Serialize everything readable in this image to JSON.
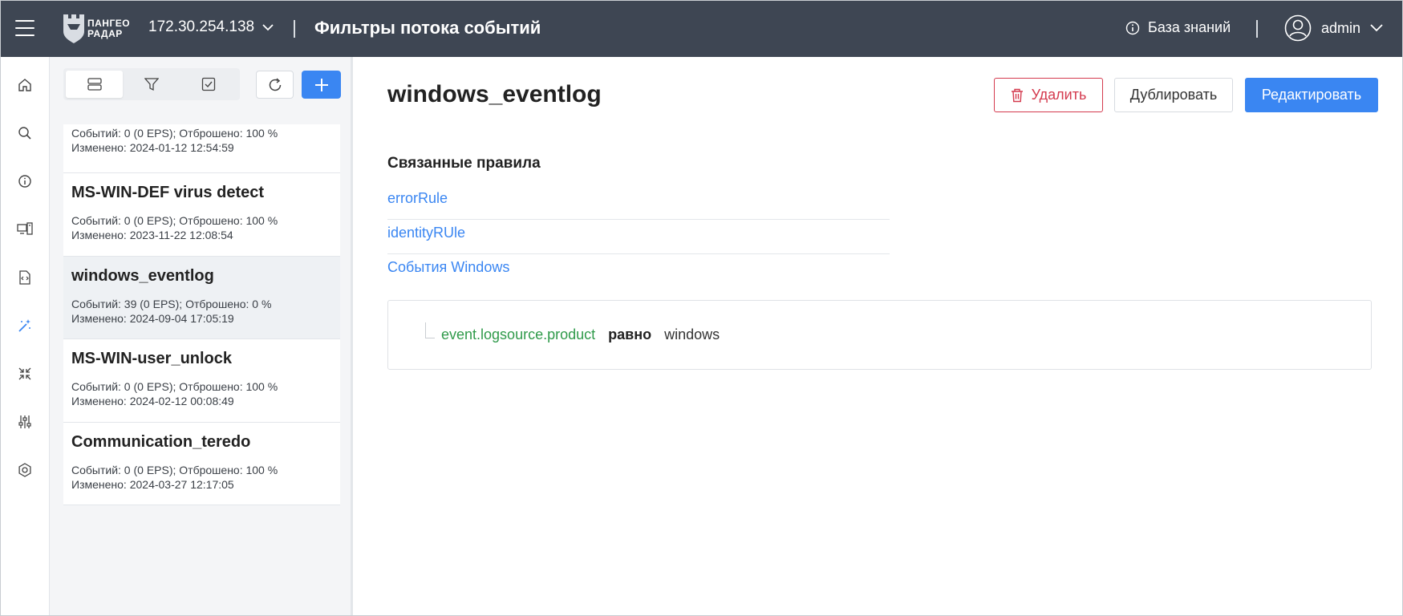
{
  "header": {
    "logo_line1": "ПАНГЕО",
    "logo_line2": "РАДАР",
    "server": "172.30.254.138",
    "page_title": "Фильтры потока событий",
    "kb_label": "База знаний",
    "user": "admin"
  },
  "nav": {
    "items": [
      "home-icon",
      "search-icon",
      "info-icon",
      "devices-icon",
      "code-file-icon",
      "magic-wand-icon",
      "collapse-arrows-icon",
      "sliders-icon",
      "settings-icon"
    ],
    "active": "magic-wand-icon"
  },
  "list": {
    "items": [
      {
        "name": "",
        "events": "Событий: 0 (0 EPS); Отброшено: 100 %",
        "changed": "Изменено: 2024-01-12 12:54:59"
      },
      {
        "name": "MS-WIN-DEF virus detect",
        "events": "Событий: 0 (0 EPS); Отброшено: 100 %",
        "changed": "Изменено: 2023-11-22 12:08:54"
      },
      {
        "name": "windows_eventlog",
        "events": "Событий: 39 (0 EPS); Отброшено: 0 %",
        "changed": "Изменено: 2024-09-04 17:05:19"
      },
      {
        "name": "MS-WIN-user_unlock",
        "events": "Событий: 0 (0 EPS); Отброшено: 100 %",
        "changed": "Изменено: 2024-02-12 00:08:49"
      },
      {
        "name": "Communication_teredo",
        "events": "Событий: 0 (0 EPS); Отброшено: 100 %",
        "changed": "Изменено: 2024-03-27 12:17:05"
      }
    ]
  },
  "detail": {
    "title": "windows_eventlog",
    "delete_label": "Удалить",
    "duplicate_label": "Дублировать",
    "edit_label": "Редактировать",
    "related_title": "Связанные правила",
    "rules": [
      "errorRule",
      "identityRUle",
      "События Windows"
    ],
    "condition": {
      "field": "event.logsource.product",
      "op": "равно",
      "value": "windows"
    }
  },
  "colors": {
    "topbar": "#3e4653",
    "accent": "#3a86f2",
    "danger": "#d43a4e",
    "field": "#2f9a4a"
  }
}
